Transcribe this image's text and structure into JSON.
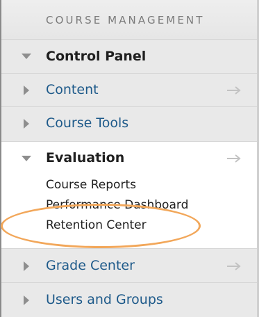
{
  "header": {
    "title": "COURSE MANAGEMENT"
  },
  "menu": {
    "control_panel": "Control Panel",
    "content": "Content",
    "course_tools": "Course Tools",
    "evaluation": "Evaluation",
    "evaluation_items": [
      "Course Reports",
      "Performance Dashboard",
      "Retention Center"
    ],
    "grade_center": "Grade Center",
    "users_and_groups": "Users and Groups"
  },
  "colors": {
    "highlight": "#f2a75a",
    "link": "#1e5a8a"
  },
  "icons": {
    "expanded": "triangle-down-icon",
    "collapsed": "triangle-right-icon",
    "open": "arrow-right-icon"
  }
}
